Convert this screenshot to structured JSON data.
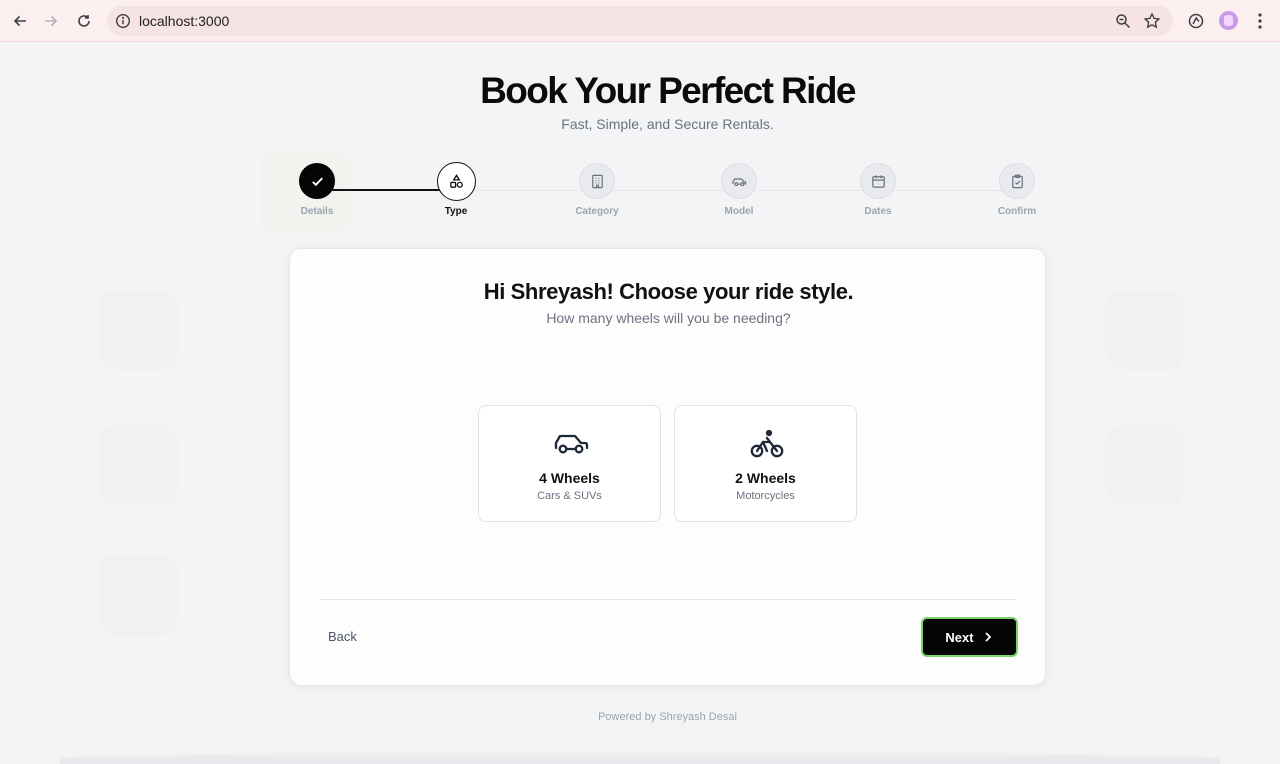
{
  "browser": {
    "url": "localhost:3000",
    "icons": [
      "back-arrow-icon",
      "forward-arrow-icon",
      "reload-icon",
      "info-icon",
      "zoom-icon",
      "star-icon",
      "extension-icon",
      "profile-avatar",
      "more-menu-icon"
    ]
  },
  "header": {
    "title": "Book Your Perfect Ride",
    "subtitle": "Fast, Simple, and Secure Rentals."
  },
  "stepper": {
    "steps": [
      {
        "label": "Details",
        "state": "completed",
        "icon": "check-icon"
      },
      {
        "label": "Type",
        "state": "current",
        "icon": "shapes-icon"
      },
      {
        "label": "Category",
        "state": "upcoming",
        "icon": "building-icon"
      },
      {
        "label": "Model",
        "state": "upcoming",
        "icon": "car-icon"
      },
      {
        "label": "Dates",
        "state": "upcoming",
        "icon": "calendar-icon"
      },
      {
        "label": "Confirm",
        "state": "upcoming",
        "icon": "clipboard-check-icon"
      }
    ]
  },
  "card": {
    "heading": "Hi Shreyash! Choose your ride style.",
    "question": "How many wheels will you be needing?",
    "options": [
      {
        "name": "4 Wheels",
        "sub": "Cars & SUVs",
        "icon": "car-icon"
      },
      {
        "name": "2 Wheels",
        "sub": "Motorcycles",
        "icon": "bike-icon"
      }
    ],
    "back_label": "Back",
    "next_label": "Next"
  },
  "footer": {
    "text": "Powered by Shreyash Desai"
  },
  "colors": {
    "accent": "#050505",
    "next_border": "#7bd36b",
    "chrome_bg": "#fcefef"
  }
}
